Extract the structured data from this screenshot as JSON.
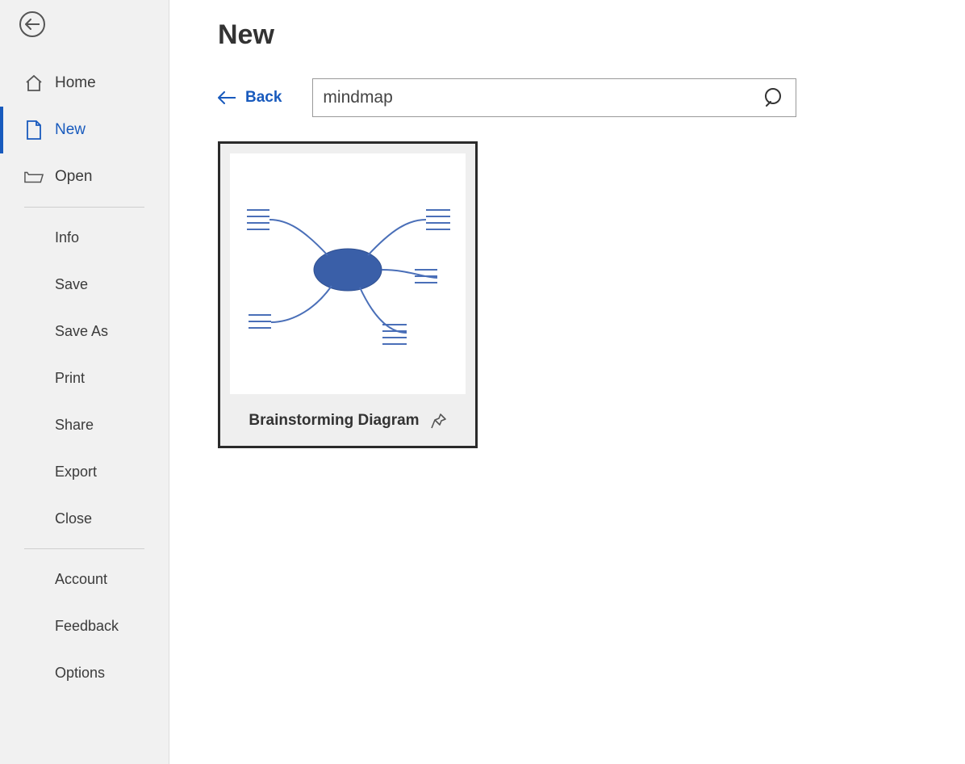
{
  "sidebar": {
    "primary": [
      {
        "label": "Home"
      },
      {
        "label": "New"
      },
      {
        "label": "Open"
      }
    ],
    "secondary": [
      {
        "label": "Info"
      },
      {
        "label": "Save"
      },
      {
        "label": "Save As"
      },
      {
        "label": "Print"
      },
      {
        "label": "Share"
      },
      {
        "label": "Export"
      },
      {
        "label": "Close"
      }
    ],
    "tertiary": [
      {
        "label": "Account"
      },
      {
        "label": "Feedback"
      },
      {
        "label": "Options"
      }
    ]
  },
  "main": {
    "title": "New",
    "back_label": "Back",
    "search_value": "mindmap",
    "templates": [
      {
        "label": "Brainstorming Diagram"
      }
    ]
  },
  "colors": {
    "accent": "#185abd",
    "shape_fill": "#3a5fa8",
    "shape_stroke": "#4a6fb8"
  }
}
